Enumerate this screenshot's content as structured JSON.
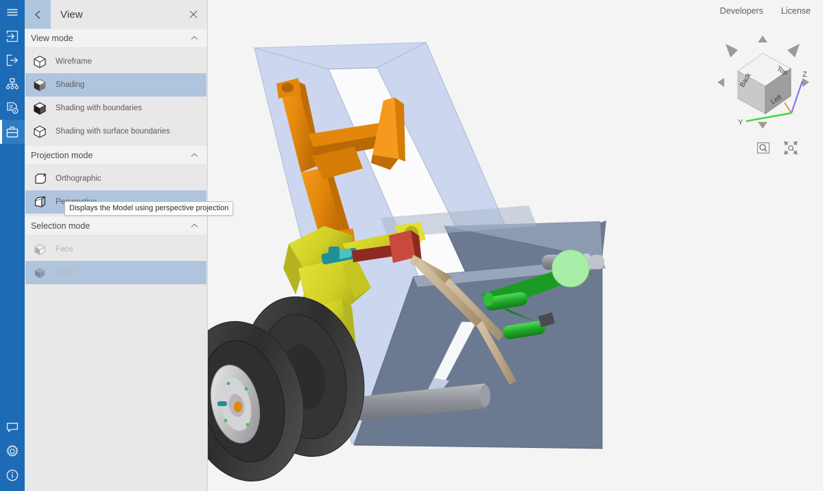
{
  "app": {
    "viewport_bg": "#f4f4f4",
    "accent_blue": "#1d6bb5",
    "select_blue": "#aec5dd"
  },
  "rail": {
    "items": [
      {
        "name": "menu-icon",
        "label": "Menu",
        "active": false
      },
      {
        "name": "import-icon",
        "label": "Import",
        "active": false
      },
      {
        "name": "export-icon",
        "label": "Export",
        "active": false
      },
      {
        "name": "model-tree-icon",
        "label": "Structure",
        "active": false
      },
      {
        "name": "properties-icon",
        "label": "Properties",
        "active": false
      },
      {
        "name": "toolbox-icon",
        "label": "Tools",
        "active": true
      }
    ],
    "bottom_items": [
      {
        "name": "feedback-icon",
        "label": "Feedback"
      },
      {
        "name": "settings-icon",
        "label": "Settings"
      },
      {
        "name": "info-icon",
        "label": "About"
      }
    ]
  },
  "panel": {
    "title": "View",
    "back_icon": "chevron-left-icon",
    "close_icon": "close-icon",
    "sections": [
      {
        "id": "view-mode",
        "label": "View mode",
        "collapse_icon": "chevron-up-icon",
        "options": [
          {
            "label": "Wireframe",
            "icon": "cube-wireframe-icon",
            "selected": false,
            "disabled": false
          },
          {
            "label": "Shading",
            "icon": "cube-shaded-icon",
            "selected": true,
            "disabled": false
          },
          {
            "label": "Shading with boundaries",
            "icon": "cube-shaded-edges-icon",
            "selected": false,
            "disabled": false
          },
          {
            "label": "Shading with surface boundaries",
            "icon": "cube-surface-edges-icon",
            "selected": false,
            "disabled": false
          }
        ]
      },
      {
        "id": "projection-mode",
        "label": "Projection mode",
        "collapse_icon": "chevron-up-icon",
        "options": [
          {
            "label": "Orthographic",
            "icon": "cube-ortho-icon",
            "selected": false,
            "disabled": false
          },
          {
            "label": "Perspective",
            "icon": "cube-perspective-icon",
            "selected": true,
            "disabled": false
          }
        ]
      },
      {
        "id": "selection-mode",
        "label": "Selection mode",
        "collapse_icon": "chevron-up-icon",
        "options": [
          {
            "label": "Face",
            "icon": "cube-face-icon",
            "selected": false,
            "disabled": true
          },
          {
            "label": "Body",
            "icon": "cube-body-icon",
            "selected": true,
            "disabled": true
          }
        ]
      }
    ],
    "tooltip": "Displays the Model using perspective projection"
  },
  "topnav": {
    "links": [
      {
        "label": "Developers"
      },
      {
        "label": "License"
      }
    ]
  },
  "navcube": {
    "faces": {
      "top": "Top",
      "back": "Back",
      "left": "Left"
    },
    "axes": [
      {
        "label": "Z",
        "color": "#7b7bf0"
      },
      {
        "label": "Y",
        "color": "#3ddc3d"
      }
    ],
    "arrows": [
      "arrow-up-icon",
      "arrow-down-icon",
      "arrow-left-icon",
      "arrow-right-icon",
      "arrow-rotate-ccw-icon",
      "arrow-rotate-cw-icon"
    ],
    "tools": [
      {
        "label": "Zoom to window",
        "icon": "zoom-window-icon"
      },
      {
        "label": "Fit all",
        "icon": "fit-all-icon"
      }
    ]
  },
  "model": {
    "name": "landing-gear-assembly",
    "colors": {
      "wing_top": "#ccd7ef",
      "wing_side": "#6c7a91",
      "wing_edge": "#8d9ab0",
      "strut_orange": "#ee8c10",
      "strut_orange_dark": "#c96f05",
      "yoke_yellow": "#d5d52a",
      "yoke_yellow_dark": "#b4b41f",
      "link_green": "#22b32a",
      "link_green_light": "#a8eda8",
      "link_green_dark": "#0f7a18",
      "rod_tan": "#bda887",
      "rod_red": "#a42a22",
      "rod_red_light": "#c94a3c",
      "axle_grey": "#8b8f95",
      "tire_black": "#3a3a3a",
      "rim_silver": "#c8c8cc",
      "teal": "#1f8f96"
    }
  }
}
